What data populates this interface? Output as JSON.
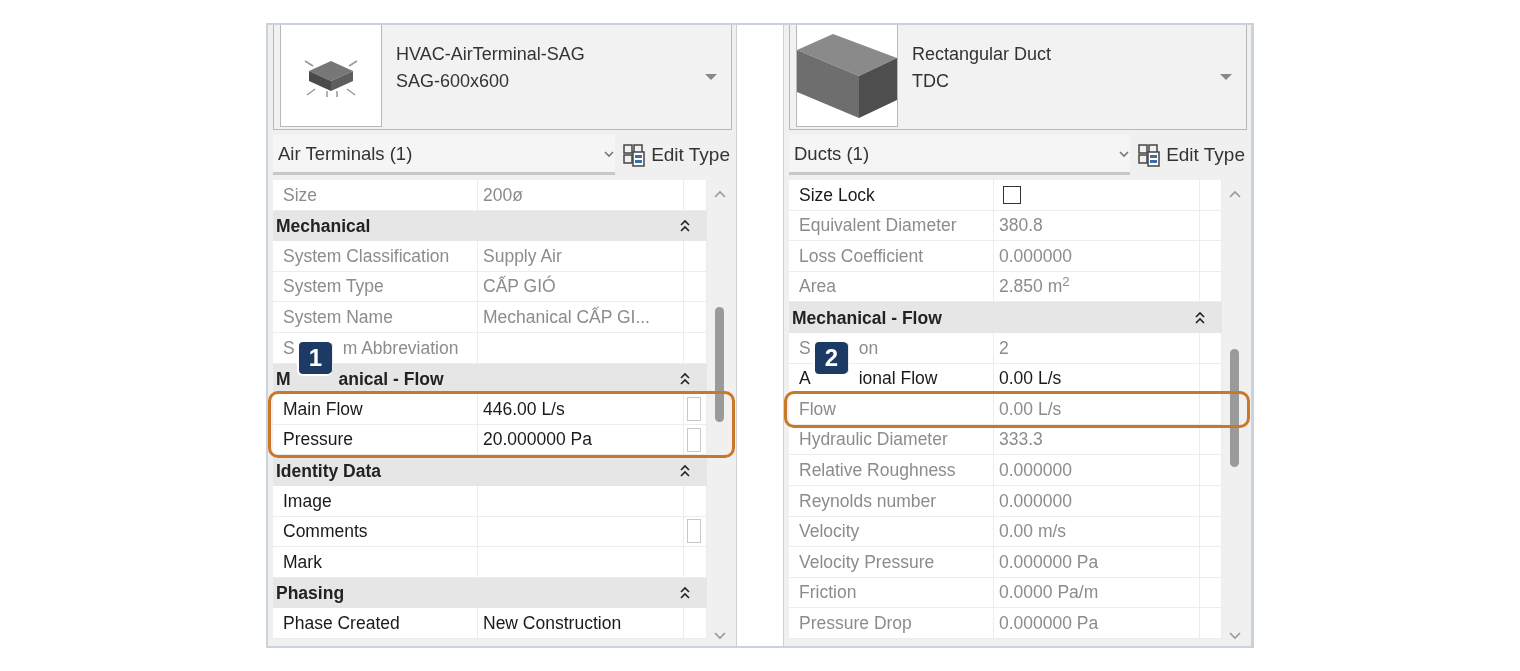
{
  "panels": [
    {
      "family": "HVAC-AirTerminal-SAG",
      "type": "SAG-600x600",
      "category": "Air Terminals (1)",
      "edit_type": "Edit Type",
      "rows": [
        {
          "kind": "property",
          "label": "Size",
          "value": "200ø",
          "editable": false
        },
        {
          "kind": "header",
          "label": "Mechanical"
        },
        {
          "kind": "property",
          "label": "System Classification",
          "value": "Supply Air",
          "editable": false
        },
        {
          "kind": "property",
          "label": "System Type",
          "value": "CẤP GIÓ",
          "editable": false
        },
        {
          "kind": "property",
          "label": "System Name",
          "value": "Mechanical CẤP GI...",
          "editable": false
        },
        {
          "kind": "property",
          "label_parts": [
            "S",
            "m Abbreviation"
          ],
          "editable": false,
          "badge": "1"
        },
        {
          "kind": "header",
          "label_parts": [
            "M",
            "anical - Flow"
          ]
        },
        {
          "kind": "property",
          "label": "Main Flow",
          "value": "446.00 L/s",
          "editable": true,
          "value_button": true,
          "highlighted": true
        },
        {
          "kind": "property",
          "label": "Pressure",
          "value": "20.000000 Pa",
          "editable": true,
          "value_button": true,
          "highlighted": true
        },
        {
          "kind": "header",
          "label": "Identity Data"
        },
        {
          "kind": "property",
          "label": "Image",
          "editable": true
        },
        {
          "kind": "property",
          "label": "Comments",
          "editable": true,
          "value_button": true
        },
        {
          "kind": "property",
          "label": "Mark",
          "editable": true
        },
        {
          "kind": "header",
          "label": "Phasing"
        },
        {
          "kind": "property",
          "label": "Phase Created",
          "value": "New Construction",
          "editable": true
        }
      ]
    },
    {
      "family": "Rectangular Duct",
      "type": "TDC",
      "category": "Ducts (1)",
      "edit_type": "Edit Type",
      "rows": [
        {
          "kind": "checkbox",
          "label": "Size Lock",
          "checked": false,
          "editable": true
        },
        {
          "kind": "property",
          "label": "Equivalent Diameter",
          "value": "380.8",
          "editable": false
        },
        {
          "kind": "property",
          "label": "Loss Coefficient",
          "value": "0.000000",
          "editable": false
        },
        {
          "kind": "property",
          "label": "Area",
          "value": "2.850 m$^{2}$",
          "editable": false
        },
        {
          "kind": "header",
          "label": "Mechanical - Flow"
        },
        {
          "kind": "property",
          "label_parts": [
            "S",
            "on"
          ],
          "value": "2",
          "editable": false,
          "badge": "2"
        },
        {
          "kind": "property",
          "label_parts": [
            "A",
            "ional Flow"
          ],
          "value": "0.00 L/s",
          "editable": true
        },
        {
          "kind": "property",
          "label": "Flow",
          "value": "0.00 L/s",
          "editable": false,
          "highlighted": true
        },
        {
          "kind": "property",
          "label": "Hydraulic Diameter",
          "value": "333.3",
          "editable": false
        },
        {
          "kind": "property",
          "label": "Relative Roughness",
          "value": "0.000000",
          "editable": false
        },
        {
          "kind": "property",
          "label": "Reynolds number",
          "value": "0.000000",
          "editable": false
        },
        {
          "kind": "property",
          "label": "Velocity",
          "value": "0.00 m/s",
          "editable": false
        },
        {
          "kind": "property",
          "label": "Velocity Pressure",
          "value": "0.000000 Pa",
          "editable": false
        },
        {
          "kind": "property",
          "label": "Friction",
          "value": "0.0000 Pa/m",
          "editable": false
        },
        {
          "kind": "property",
          "label": "Pressure Drop",
          "value": "0.000000 Pa",
          "editable": false
        }
      ]
    }
  ]
}
